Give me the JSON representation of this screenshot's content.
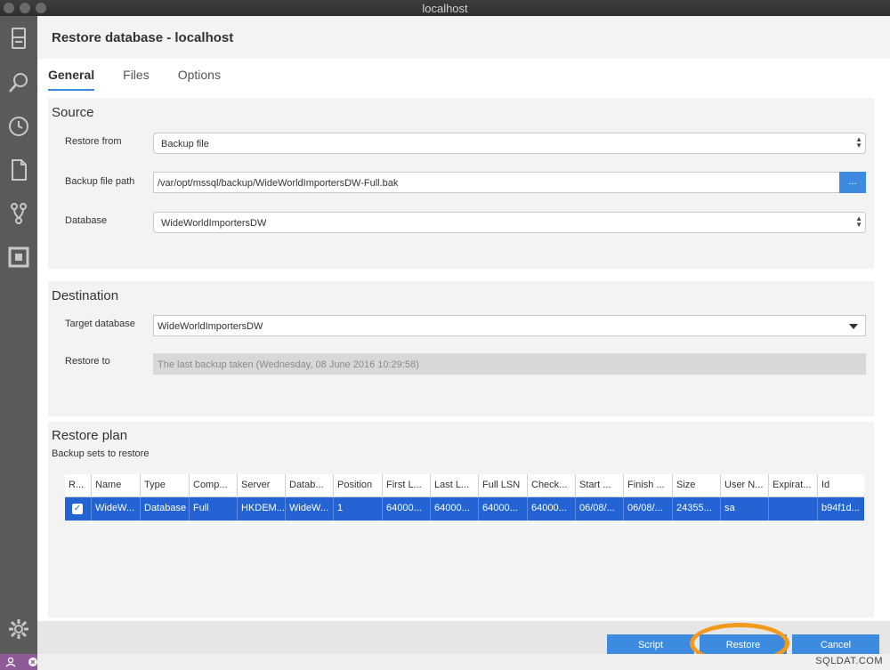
{
  "window": {
    "title": "localhost"
  },
  "activity_bar": {
    "icons": [
      "servers-icon",
      "search-icon",
      "history-icon",
      "file-icon",
      "source-control-icon",
      "extensions-icon",
      "settings-icon"
    ]
  },
  "dialog": {
    "title": "Restore database - localhost",
    "tabs": [
      {
        "label": "General",
        "active": true
      },
      {
        "label": "Files",
        "active": false
      },
      {
        "label": "Options",
        "active": false
      }
    ],
    "source": {
      "title": "Source",
      "restore_from_label": "Restore from",
      "restore_from_value": "Backup file",
      "backup_file_path_label": "Backup file path",
      "backup_file_path_value": "/var/opt/mssql/backup/WideWorldImportersDW-Full.bak",
      "browse_label": "...",
      "database_label": "Database",
      "database_value": "WideWorldImportersDW"
    },
    "destination": {
      "title": "Destination",
      "target_database_label": "Target database",
      "target_database_value": "WideWorldImportersDW",
      "restore_to_label": "Restore to",
      "restore_to_value": "The last backup taken (Wednesday, 08 June 2016 10:29:58)"
    },
    "restore_plan": {
      "title": "Restore plan",
      "subtitle": "Backup sets to restore",
      "columns": [
        "R...",
        "Name",
        "Type",
        "Comp...",
        "Server",
        "Datab...",
        "Position",
        "First L...",
        "Last L...",
        "Full LSN",
        "Check...",
        "Start ...",
        "Finish ...",
        "Size",
        "User N...",
        "Expirat...",
        "Id"
      ],
      "rows": [
        {
          "checked": true,
          "cells": [
            "",
            "WideW...",
            "Database",
            "Full",
            "HKDEM...",
            "WideW...",
            "1",
            "64000...",
            "64000...",
            "64000...",
            "64000...",
            "06/08/...",
            "06/08/...",
            "24355...",
            "sa",
            "",
            "b94f1d..."
          ]
        }
      ]
    },
    "footer": {
      "script_label": "Script",
      "restore_label": "Restore",
      "cancel_label": "Cancel"
    }
  },
  "status_bar": {
    "watermark": "SQLDAT.COM"
  },
  "colors": {
    "accent": "#3c8be0",
    "selection": "#2463d4",
    "highlight": "#f29a1d",
    "status_left": "#8e5a97"
  }
}
